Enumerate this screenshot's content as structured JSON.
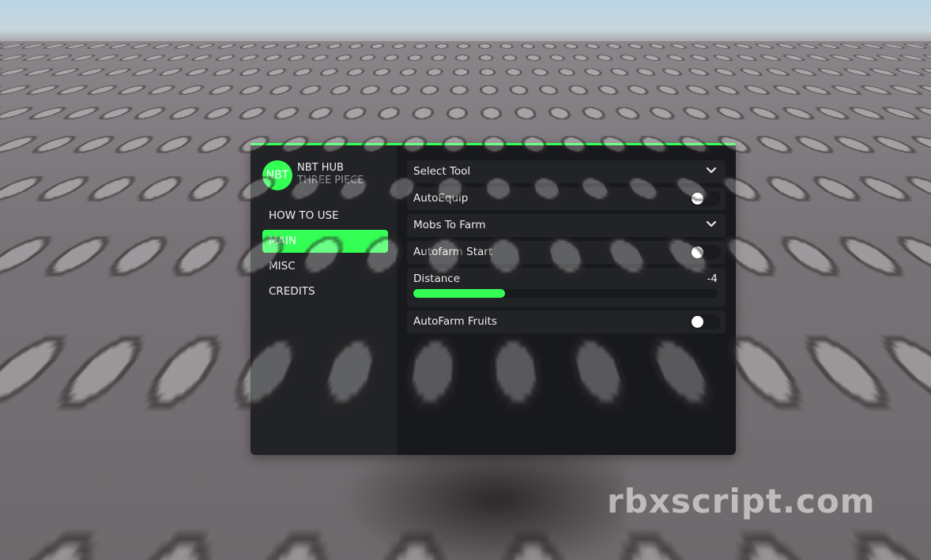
{
  "watermark": "rbxscript.com",
  "colors": {
    "accent": "#33ff55",
    "panel": "#18191c",
    "sidebar": "#222326"
  },
  "hub": {
    "logo_text": "NBT",
    "title": "NBT HUB",
    "subtitle": "THREE PIECE",
    "nav": [
      {
        "label": "HOW TO USE",
        "active": false
      },
      {
        "label": "MAIN",
        "active": true
      },
      {
        "label": "MISC",
        "active": false
      },
      {
        "label": "CREDITS",
        "active": false
      }
    ],
    "rows": [
      {
        "type": "dropdown",
        "label": "Select Tool",
        "icon": "chevron-down-icon"
      },
      {
        "type": "toggle",
        "label": "AutoEquip",
        "on": false
      },
      {
        "type": "dropdown",
        "label": "Mobs To Farm",
        "icon": "chevron-down-icon"
      },
      {
        "type": "toggle",
        "label": "Autofarm Start",
        "on": false
      },
      {
        "type": "slider",
        "label": "Distance",
        "value": "-4",
        "fill_fraction": 0.3
      },
      {
        "type": "toggle",
        "label": "AutoFarm Fruits",
        "on": false
      }
    ]
  }
}
